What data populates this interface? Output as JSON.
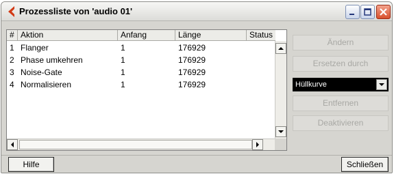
{
  "window": {
    "title": "Prozessliste von 'audio 01'"
  },
  "list": {
    "columns": [
      "#",
      "Aktion",
      "Anfang",
      "Länge",
      "Status"
    ],
    "rows": [
      [
        "1",
        "Flanger",
        "1",
        "176929",
        ""
      ],
      [
        "2",
        "Phase umkehren",
        "1",
        "176929",
        ""
      ],
      [
        "3",
        "Noise-Gate",
        "1",
        "176929",
        ""
      ],
      [
        "4",
        "Normalisieren",
        "1",
        "176929",
        ""
      ]
    ]
  },
  "side": {
    "aendern": "Ändern",
    "ersetzen": "Ersetzen durch",
    "dropdown_value": "Hüllkurve",
    "entfernen": "Entfernen",
    "deaktivieren": "Deaktivieren"
  },
  "footer": {
    "hilfe": "Hilfe",
    "schliessen": "Schließen"
  },
  "colors": {
    "window_bg": "#d6d5d0",
    "title_icon": "#d23a16",
    "close_button": "#d8502d",
    "dropdown_bg": "#000000",
    "disabled_text": "#a8a8a4"
  }
}
